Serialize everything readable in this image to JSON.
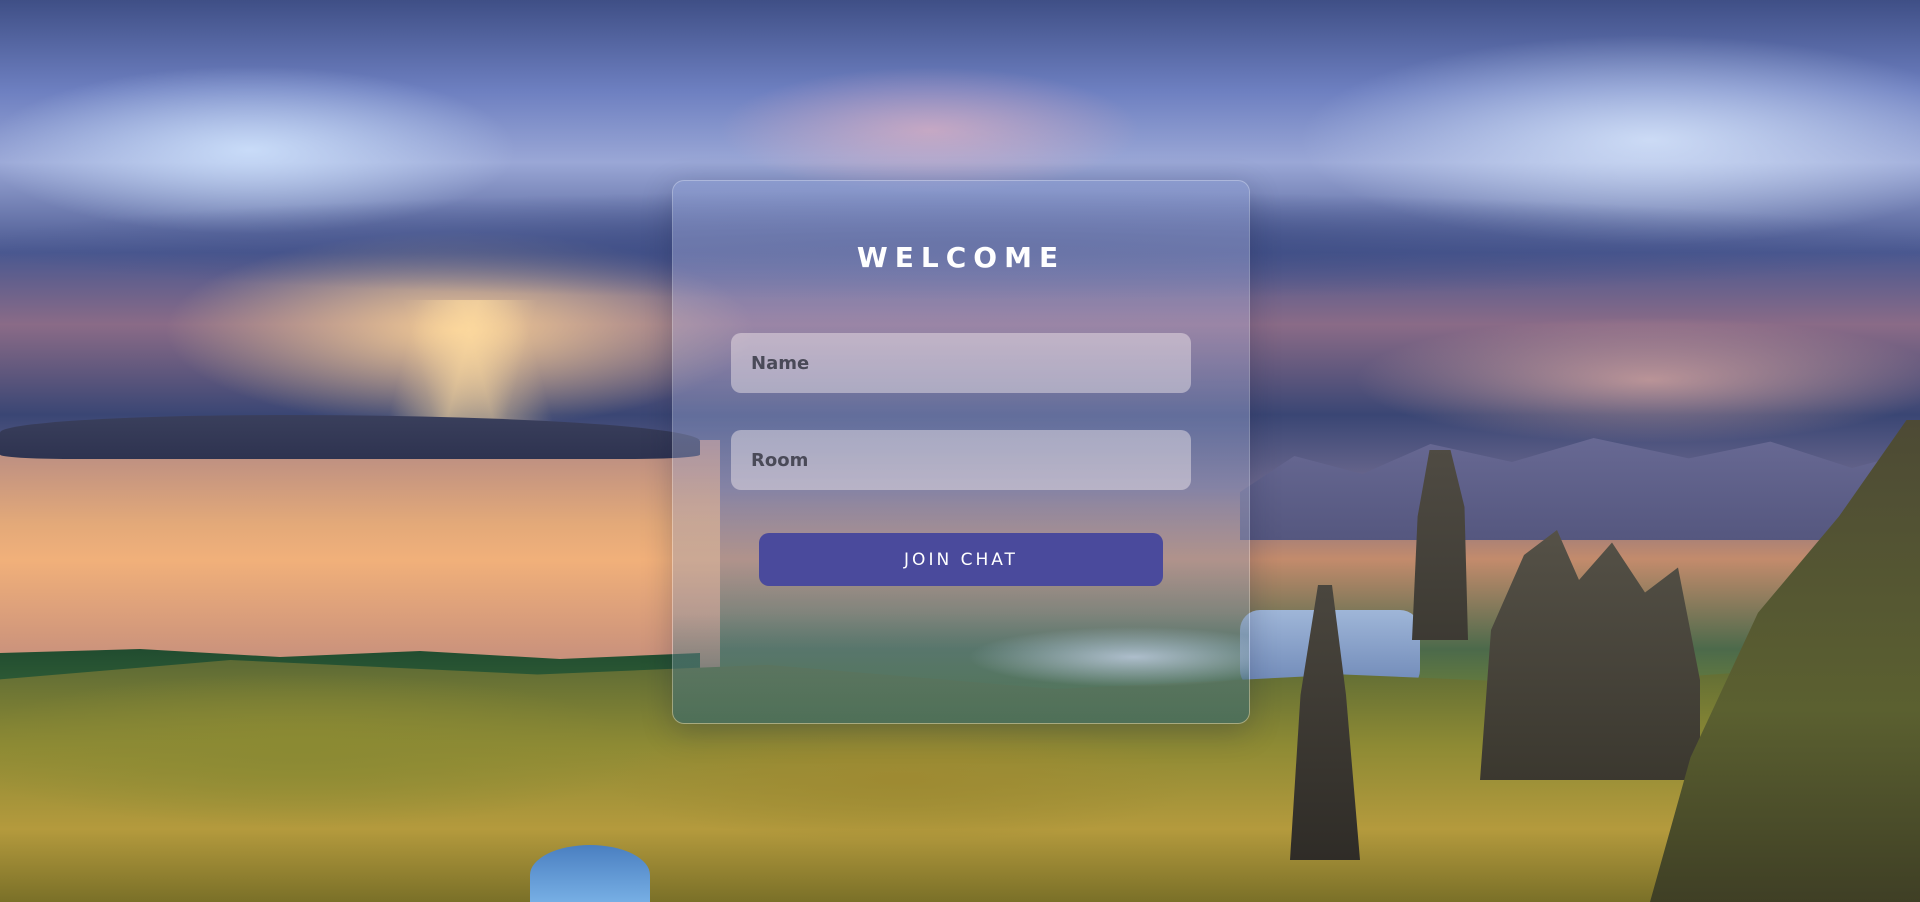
{
  "login": {
    "title": "WELCOME",
    "name_placeholder": "Name",
    "name_value": "",
    "room_placeholder": "Room",
    "room_value": "",
    "join_label": "JOIN CHAT"
  },
  "colors": {
    "button": "#4a4a9c",
    "title": "#ffffff"
  }
}
